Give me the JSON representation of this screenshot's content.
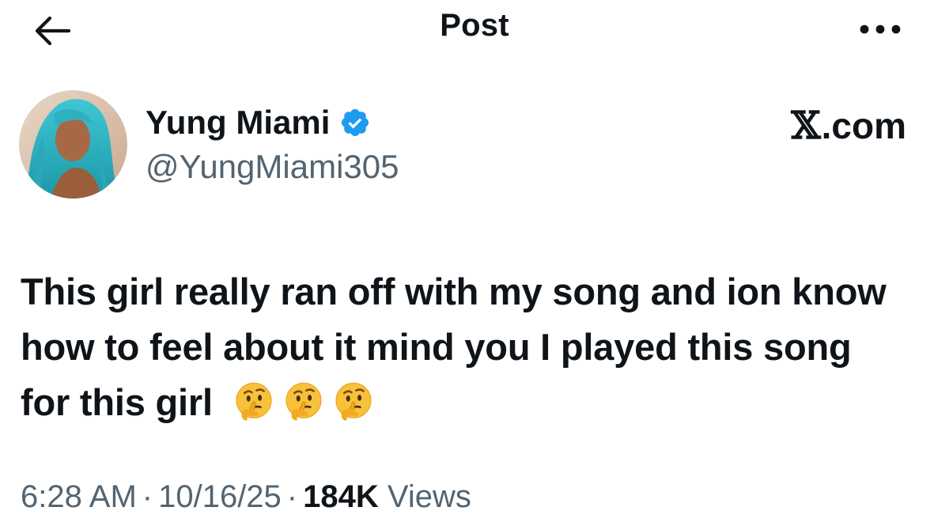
{
  "header": {
    "title": "Post",
    "back_icon": "arrow-left-icon",
    "more_icon": "more-horizontal-icon"
  },
  "author": {
    "name": "Yung Miami",
    "handle": "@YungMiami305",
    "verified": true,
    "verified_color": "#1d9bf0",
    "avatar_hair_color": "#35b9c9"
  },
  "source": {
    "x_letter": "𝕏",
    "domain": ".com"
  },
  "tweet": {
    "text": "This girl really ran off with my song and ion know how to feel about it mind you I played this song for this girl",
    "emojis": [
      "thinking-face",
      "thinking-face",
      "thinking-face"
    ]
  },
  "meta": {
    "time": "6:28 AM",
    "separator": "·",
    "date": "10/16/25",
    "views_count": "184K",
    "views_label": "Views"
  },
  "colors": {
    "text_primary": "#0f1419",
    "text_secondary": "#536471",
    "background": "#ffffff"
  }
}
